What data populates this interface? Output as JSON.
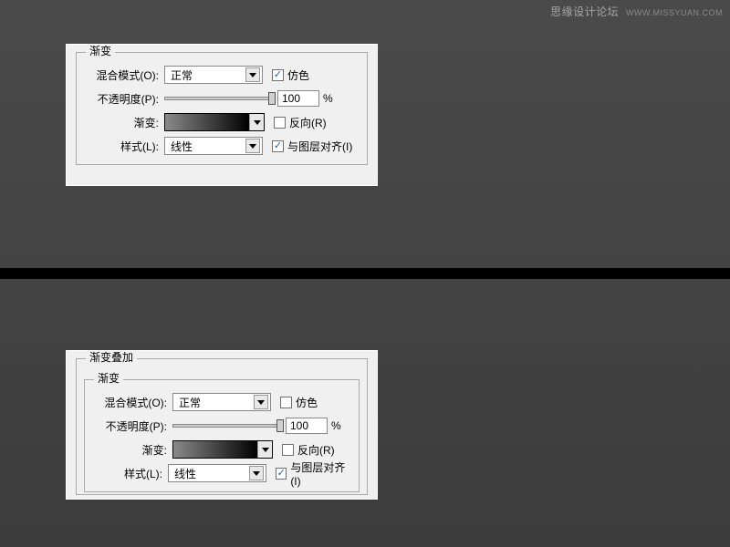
{
  "watermark": {
    "main": "思缘设计论坛",
    "sub": "WWW.MISSYUAN.COM"
  },
  "panel1": {
    "group_title": "渐变",
    "blend": {
      "label": "混合模式(O):",
      "value": "正常"
    },
    "dither": {
      "label": "仿色",
      "checked": true
    },
    "opacity": {
      "label": "不透明度(P):",
      "value": "100",
      "unit": "%",
      "slider": 100
    },
    "gradient": {
      "label": "渐变:",
      "start": "#8a8a8a",
      "end": "#000000"
    },
    "reverse": {
      "label": "反向(R)",
      "checked": false
    },
    "style": {
      "label": "样式(L):",
      "value": "线性"
    },
    "align": {
      "label": "与图层对齐(I)",
      "checked": true
    }
  },
  "panel2": {
    "outer_title": "渐变叠加",
    "group_title": "渐变",
    "blend": {
      "label": "混合模式(O):",
      "value": "正常"
    },
    "dither": {
      "label": "仿色",
      "checked": false
    },
    "opacity": {
      "label": "不透明度(P):",
      "value": "100",
      "unit": "%",
      "slider": 100
    },
    "gradient": {
      "label": "渐变:",
      "start": "#8a8a8a",
      "end": "#000000"
    },
    "reverse": {
      "label": "反向(R)",
      "checked": false
    },
    "style": {
      "label": "样式(L):",
      "value": "线性"
    },
    "align": {
      "label": "与图层对齐(I)",
      "checked": true
    }
  }
}
